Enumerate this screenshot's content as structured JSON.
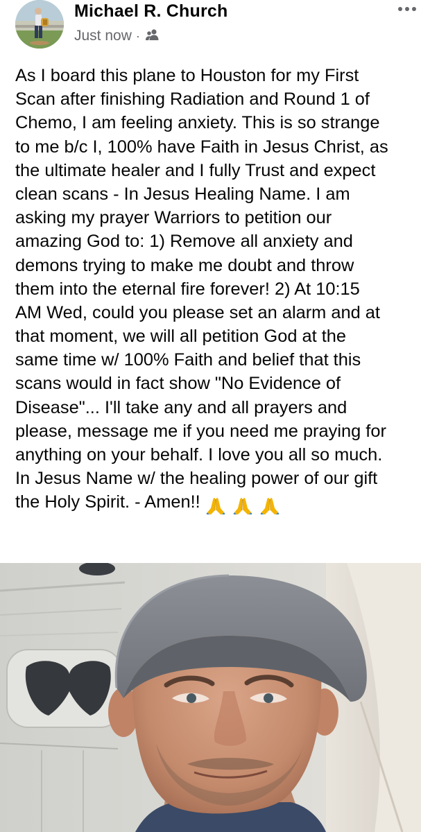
{
  "post": {
    "author_name": "Michael R. Church",
    "timestamp": "Just now",
    "separator": "·",
    "audience_icon": "friends-icon",
    "more_icon": "more-options-icon",
    "text_lines": [
      "As I board this plane to Houston for my First",
      "Scan after finishing Radiation and Round 1 of",
      "Chemo, I am feeling anxiety. This is so strange",
      "to me b/c I, 100% have Faith in Jesus Christ, as",
      "the ultimate healer and I fully Trust and expect",
      "clean scans - In Jesus Healing Name. I am",
      "asking my prayer Warriors to petition our",
      "amazing God to: 1) Remove all anxiety and",
      "demons trying to make me doubt and throw",
      "them into the eternal fire forever! 2) At 10:15",
      "AM Wed, could you please set an alarm and at",
      "that moment, we will all petition God at the",
      "same time w/ 100% Faith and belief that this",
      "scans would in fact show \"No Evidence of",
      "Disease\"... I'll take any and all prayers and",
      "please, message me if you need me praying for",
      "anything on your behalf. I love you all so much.",
      "In Jesus Name w/ the healing power of our gift",
      "the Holy Spirit. - Amen!!"
    ],
    "trailing_emoji_icon": "folded-hands-icon",
    "trailing_emoji_count": 3,
    "photo_subject": "selfie-photo"
  },
  "colors": {
    "name": "#050505",
    "meta": "#65676b",
    "body_text": "#050505",
    "background": "#ffffff"
  }
}
